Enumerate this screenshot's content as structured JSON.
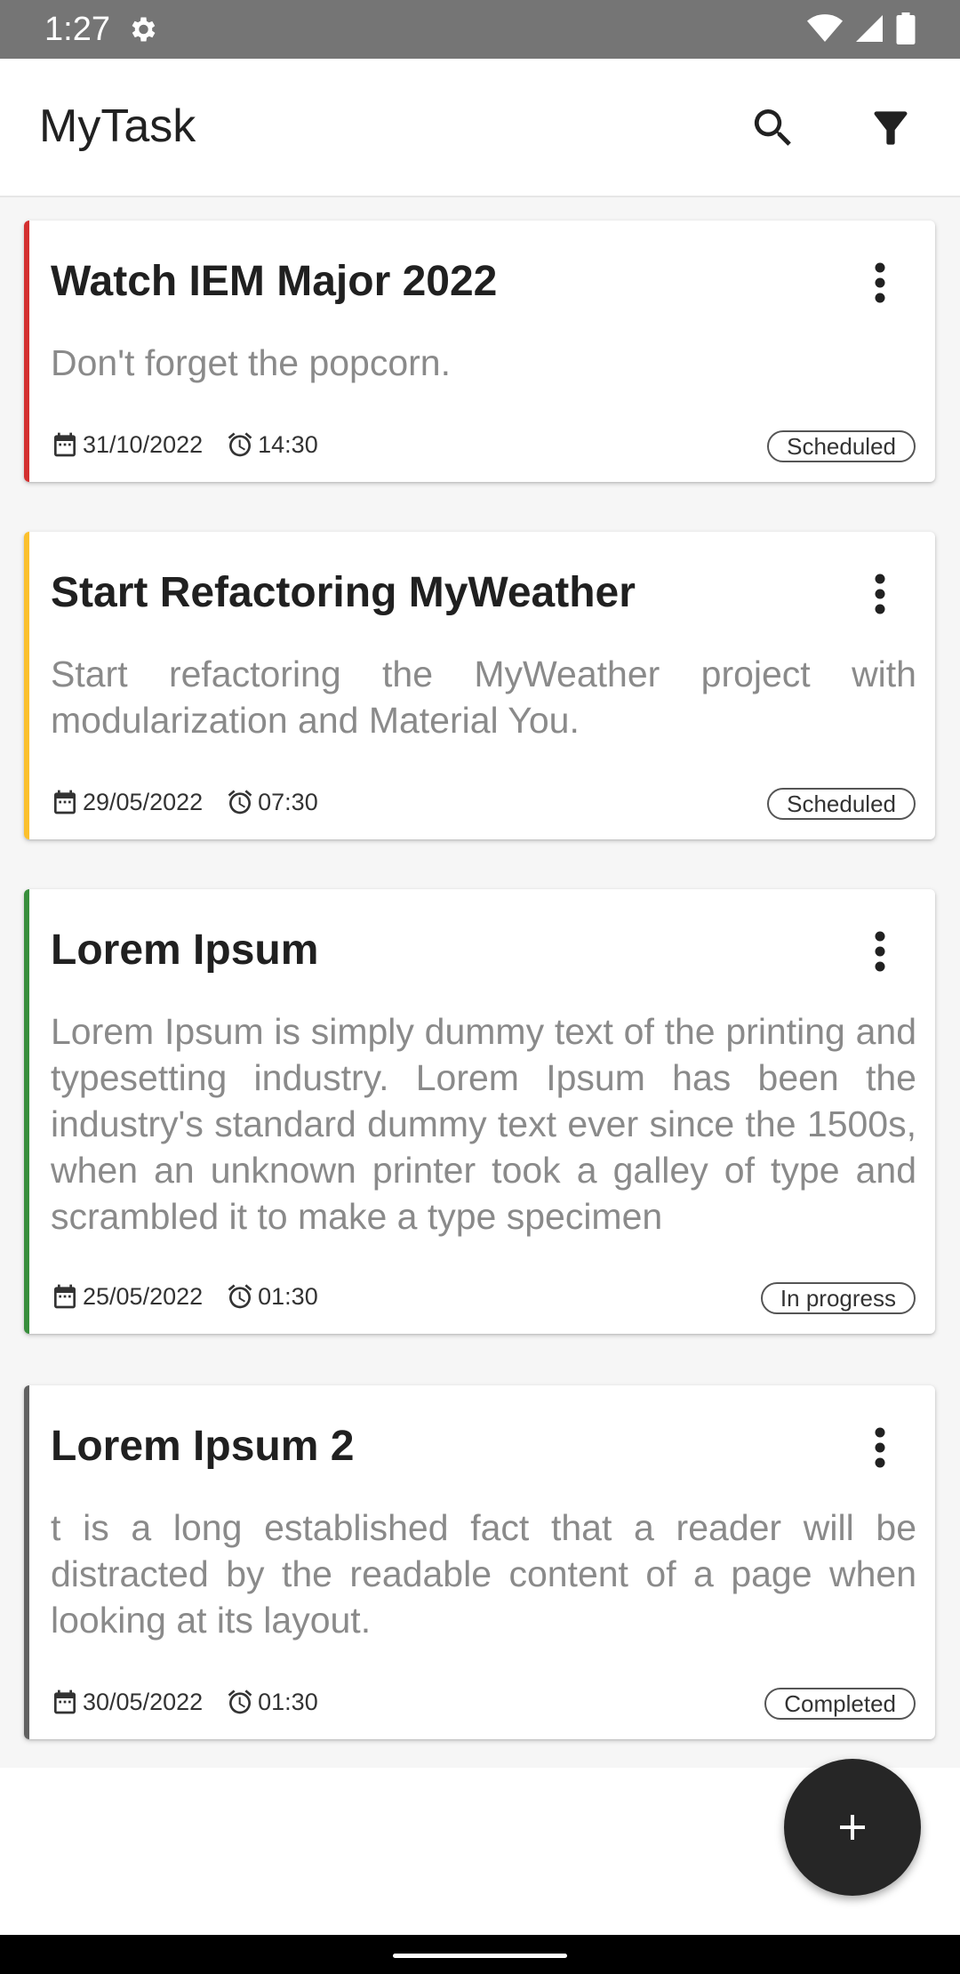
{
  "status_bar": {
    "time": "1:27",
    "icons": [
      "gear-icon",
      "wifi-icon",
      "signal-icon",
      "battery-icon"
    ]
  },
  "app_bar": {
    "title": "MyTask",
    "actions": [
      "search-icon",
      "filter-icon"
    ]
  },
  "tasks": [
    {
      "title": "Watch IEM Major 2022",
      "description": "Don't forget the popcorn.",
      "date": "31/10/2022",
      "time": "14:30",
      "status": "Scheduled",
      "accent_color": "#d32f2f"
    },
    {
      "title": "Start Refactoring MyWeather",
      "description": "Start refactoring the MyWeather project with modularization and Material You.",
      "date": "29/05/2022",
      "time": "07:30",
      "status": "Scheduled",
      "accent_color": "#fbc02d"
    },
    {
      "title": "Lorem Ipsum",
      "description": "Lorem Ipsum is simply dummy text of the printing and typesetting industry. Lorem Ipsum has been the industry's standard dummy text ever since the 1500s, when an unknown printer took a galley of type and scrambled it to make a type specimen",
      "date": "25/05/2022",
      "time": "01:30",
      "status": "In progress",
      "accent_color": "#388e3c"
    },
    {
      "title": "Lorem Ipsum 2",
      "description": "t is a long established fact that a reader will be distracted by the readable content of a page when looking at its layout.",
      "date": "30/05/2022",
      "time": "01:30",
      "status": "Completed",
      "accent_color": "#616161"
    }
  ],
  "fab": {
    "icon": "plus-icon"
  }
}
